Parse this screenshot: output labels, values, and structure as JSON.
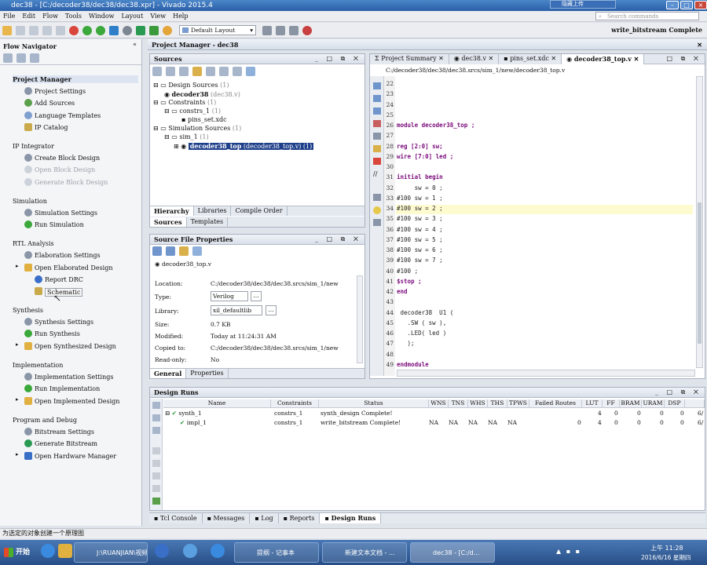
{
  "window": {
    "title": "dec38 - [C:/decoder38/dec38/dec38.xpr] - Vivado 2015.4"
  },
  "menu": [
    "File",
    "Edit",
    "Flow",
    "Tools",
    "Window",
    "Layout",
    "View",
    "Help"
  ],
  "search": {
    "placeholder": "Search commands"
  },
  "toolbar": {
    "layout": "Default Layout",
    "status": "write_bitstream Complete"
  },
  "flow_navigator": {
    "title": "Flow Navigator",
    "sections": [
      {
        "label": "Project Manager",
        "items": [
          "Project Settings",
          "Add Sources",
          "Language Templates",
          "IP Catalog"
        ]
      },
      {
        "label": "IP Integrator",
        "items": [
          "Create Block Design",
          "Open Block Design",
          "Generate Block Design"
        ]
      },
      {
        "label": "Simulation",
        "items": [
          "Simulation Settings",
          "Run Simulation"
        ]
      },
      {
        "label": "RTL Analysis",
        "items": [
          "Elaboration Settings",
          "Open Elaborated Design",
          "Report DRC",
          "Schematic"
        ]
      },
      {
        "label": "Synthesis",
        "items": [
          "Synthesis Settings",
          "Run Synthesis",
          "Open Synthesized Design"
        ]
      },
      {
        "label": "Implementation",
        "items": [
          "Implementation Settings",
          "Run Implementation",
          "Open Implemented Design"
        ]
      },
      {
        "label": "Program and Debug",
        "items": [
          "Bitstream Settings",
          "Generate Bitstream",
          "Open Hardware Manager"
        ]
      }
    ]
  },
  "project_manager": {
    "title": "Project Manager - dec38"
  },
  "sources": {
    "title": "Sources",
    "tree": [
      {
        "label": "Design Sources",
        "count": "(1)"
      },
      {
        "label": "decoder38",
        "detail": "(dec38.v)"
      },
      {
        "label": "Constraints",
        "count": "(1)"
      },
      {
        "label": "constrs_1",
        "count": "(1)"
      },
      {
        "label": "pins_set.xdc"
      },
      {
        "label": "Simulation Sources",
        "count": "(1)"
      },
      {
        "label": "sim_1",
        "count": "(1)"
      },
      {
        "label": "decoder38_top",
        "detail": "(decoder38_top.v) (1)"
      }
    ],
    "tabs": [
      "Hierarchy",
      "Libraries",
      "Compile Order"
    ],
    "subtabs": [
      "Sources",
      "Templates"
    ]
  },
  "file_properties": {
    "title": "Source File Properties",
    "file": "decoder38_top.v",
    "rows": [
      {
        "label": "Location:",
        "value": "C:/decoder38/dec38/dec38.srcs/sim_1/new"
      },
      {
        "label": "Type:",
        "value": "Verilog"
      },
      {
        "label": "Library:",
        "value": "xil_defaultlib"
      },
      {
        "label": "Size:",
        "value": "0.7 KB"
      },
      {
        "label": "Modified:",
        "value": "Today at 11:24:31 AM"
      },
      {
        "label": "Copied to:",
        "value": "C:/decoder38/dec38/dec38.srcs/sim_1/new"
      },
      {
        "label": "Read-only:",
        "value": "No"
      }
    ],
    "tabs": [
      "General",
      "Properties"
    ]
  },
  "editor": {
    "tabs": [
      "Project Summary",
      "dec38.v",
      "pins_set.xdc",
      "decoder38_top.v"
    ],
    "path": "C:/decoder38/dec38/dec38.srcs/sim_1/new/decoder38_top.v",
    "lines": [
      {
        "n": "22",
        "text": ""
      },
      {
        "n": "23",
        "text": ""
      },
      {
        "n": "24",
        "text": ""
      },
      {
        "n": "25",
        "text": ""
      },
      {
        "n": "26",
        "text": "module decoder38_top ;"
      },
      {
        "n": "27",
        "text": ""
      },
      {
        "n": "28",
        "text": "reg [2:0] sw;"
      },
      {
        "n": "29",
        "text": "wire [7:0] led ;"
      },
      {
        "n": "30",
        "text": ""
      },
      {
        "n": "31",
        "text": "initial begin"
      },
      {
        "n": "32",
        "text": "     sw = 0 ;"
      },
      {
        "n": "33",
        "text": "#100 sw = 1 ;"
      },
      {
        "n": "34",
        "text": "#100 sw = 2 ;"
      },
      {
        "n": "35",
        "text": "#100 sw = 3 ;"
      },
      {
        "n": "36",
        "text": "#100 sw = 4 ;"
      },
      {
        "n": "37",
        "text": "#100 sw = 5 ;"
      },
      {
        "n": "38",
        "text": "#100 sw = 6 ;"
      },
      {
        "n": "39",
        "text": "#100 sw = 7 ;"
      },
      {
        "n": "40",
        "text": "#100 ;"
      },
      {
        "n": "41",
        "text": "$stop ;"
      },
      {
        "n": "42",
        "text": "end"
      },
      {
        "n": "43",
        "text": ""
      },
      {
        "n": "44",
        "text": " decoder38  U1 ("
      },
      {
        "n": "45",
        "text": "   .SW ( sw ),"
      },
      {
        "n": "46",
        "text": "   .LED( led )"
      },
      {
        "n": "47",
        "text": "   );"
      },
      {
        "n": "48",
        "text": ""
      },
      {
        "n": "49",
        "text": "endmodule"
      }
    ]
  },
  "design_runs": {
    "title": "Design Runs",
    "columns": [
      "Name",
      "Constraints",
      "Status",
      "WNS",
      "TNS",
      "WHS",
      "THS",
      "TPWS",
      "Failed Routes",
      "LUT",
      "FF",
      "BRAM",
      "URAM",
      "DSP"
    ],
    "rows": [
      {
        "name": "synth_1",
        "constraints": "constrs_1",
        "status": "synth_design Complete!",
        "wns": "",
        "tns": "",
        "whs": "",
        "ths": "",
        "tpws": "",
        "failed": "",
        "lut": "4",
        "ff": "0",
        "bram": "0",
        "uram": "0",
        "dsp": "0",
        "io": "6/"
      },
      {
        "name": "impl_1",
        "constraints": "constrs_1",
        "status": "write_bitstream Complete!",
        "wns": "NA",
        "tns": "NA",
        "whs": "NA",
        "ths": "NA",
        "tpws": "NA",
        "failed": "0",
        "lut": "4",
        "ff": "0",
        "bram": "0",
        "uram": "0",
        "dsp": "0",
        "io": "6/"
      }
    ]
  },
  "bottom_tabs": [
    "Tcl Console",
    "Messages",
    "Log",
    "Reports",
    "Design Runs"
  ],
  "status_bar": "为选定的对象创建一个原理图",
  "taskbar": {
    "start": "开始",
    "tasks": [
      "J:\\RUANJIAN\\视频...",
      "提纲 - 记事本",
      "新建文本文档 - ...",
      "dec38 - [C:/d..."
    ],
    "clock_time": "上午 11:28",
    "clock_date": "2016/6/16 星期四"
  },
  "overlay": {
    "label": "隐藏上传"
  }
}
